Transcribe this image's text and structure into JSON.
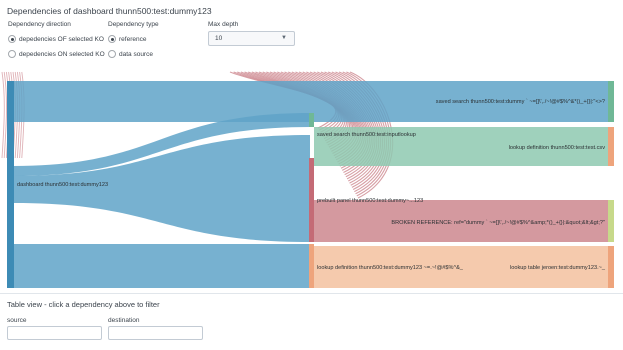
{
  "panel": {
    "title": "Dependencies of dashboard thunn500:test:dummy123"
  },
  "controls": {
    "direction": {
      "label": "Dependency direction",
      "options": [
        "depedencies OF selected KO",
        "depedencies ON selected KO"
      ],
      "selected_index": 0
    },
    "dep_type": {
      "label": "Dependency type",
      "options": [
        "reference",
        "data source"
      ],
      "selected_index": 0
    },
    "max_depth": {
      "label": "Max depth",
      "value": "10"
    }
  },
  "sankey": {
    "nodes": {
      "root": "dashboard thunn500:test:dummy123",
      "saved_search_top": "saved search thunn500:test:dummy ` ~=[]\\',./~!@#$%^&*()_+{}|:\"<>?",
      "saved_search_mid": "saved search thunn500:test:inputlookup",
      "lookup_def_csv": "lookup definition thunn500:test:test.csv",
      "prebuilt_panel": "prebuilt panel thunn500:test:dummy~...123",
      "broken_ref": "BROKEN REFERENCE: ref=\"dummy ` ~=[]\\',./~!@#$%^&amp;*()_+{}|:&quot;&lt;&gt;?\"",
      "lookup_def_dummy": "lookup definition thunn500:test:dummy123 ~=.~!@#$%^&_",
      "lookup_table": "lookup table jeroen:test:dummy123.~_"
    },
    "colors": {
      "blue": "#5fa3c8",
      "blue_node": "#3d8bb5",
      "green": "#8ec9b0",
      "green_node": "#6fb896",
      "red": "#c97f87",
      "red_node": "#c46b76",
      "orange": "#f4c4a4",
      "orange_node": "#eea47c",
      "lime_node": "#c7d98a"
    }
  },
  "table_view": {
    "title": "Table view - click a dependency above to filter",
    "source_label": "source",
    "destination_label": "destination"
  }
}
